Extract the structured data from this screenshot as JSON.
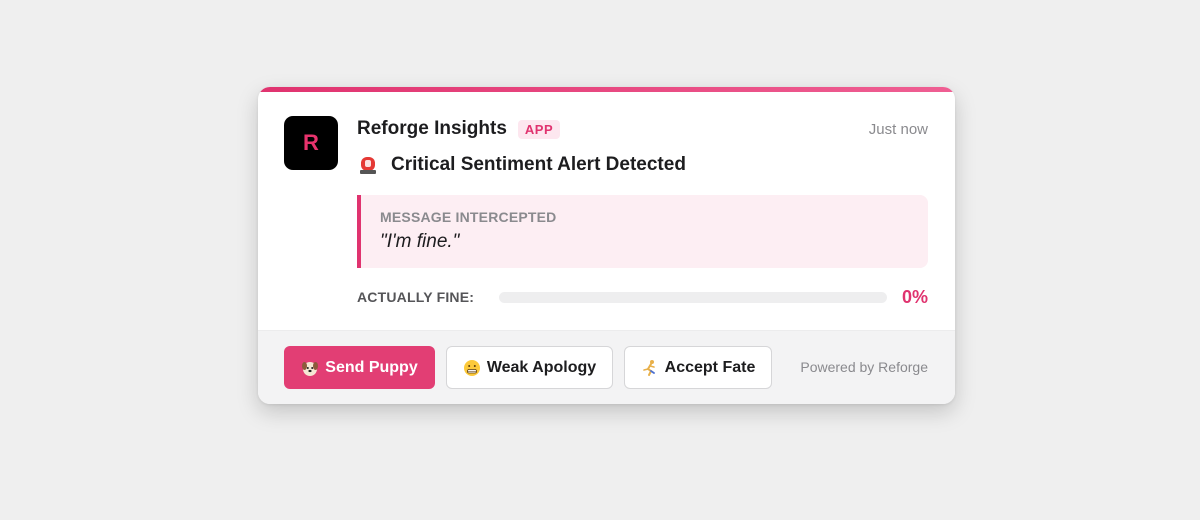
{
  "notification": {
    "app_name": "Reforge Insights",
    "avatar_letter": "R",
    "badge": "APP",
    "timestamp": "Just now",
    "title_icon": "siren-icon",
    "title": "Critical Sentiment Alert Detected",
    "intercept": {
      "label": "MESSAGE INTERCEPTED",
      "quote": "\"I'm fine.\""
    },
    "metric": {
      "label": "ACTUALLY FINE:",
      "value_text": "0%",
      "value": 0
    }
  },
  "footer": {
    "buttons": [
      {
        "icon": "puppy-icon",
        "label": "Send Puppy"
      },
      {
        "icon": "grimace-face-icon",
        "label": "Weak Apology"
      },
      {
        "icon": "running-person-icon",
        "label": "Accept Fate"
      }
    ],
    "powered_by": "Powered by Reforge"
  },
  "colors": {
    "accent": "#e0336f",
    "badge_bg": "#fde7ef",
    "quote_bg": "#fdeef3",
    "background": "#efefef"
  }
}
